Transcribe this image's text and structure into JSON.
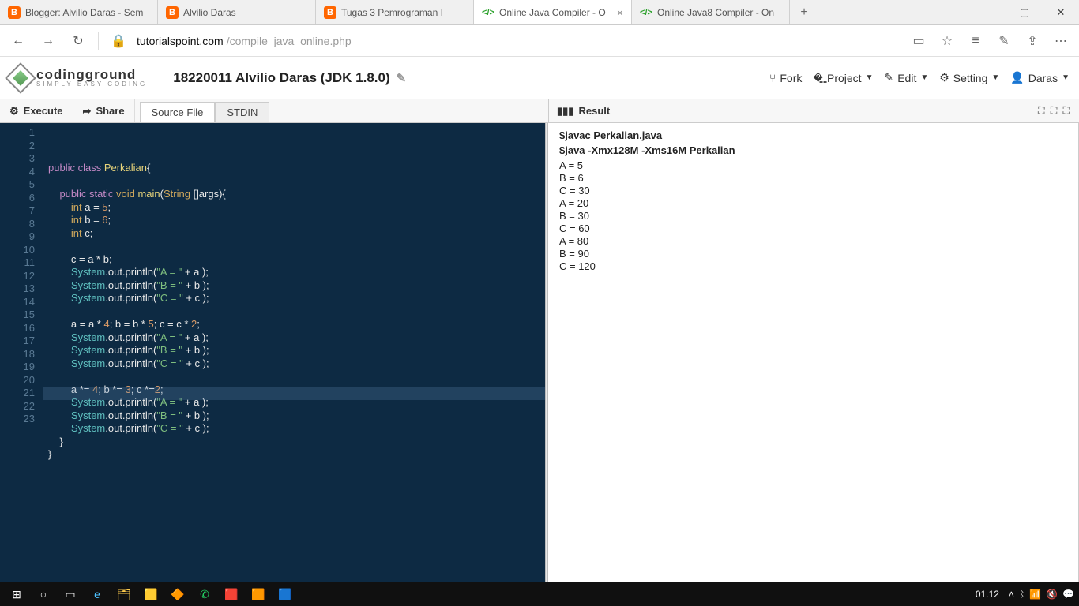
{
  "browserTabs": [
    {
      "icon": "B",
      "iconClass": "blogger-ico",
      "label": "Blogger: Alvilio Daras - Sem"
    },
    {
      "icon": "B",
      "iconClass": "blogger-ico",
      "label": "Alvilio Daras"
    },
    {
      "icon": "B",
      "iconClass": "blogger-ico",
      "label": "Tugas 3 Pemrograman I"
    },
    {
      "icon": "</>",
      "iconClass": "tp-ico",
      "label": "Online Java Compiler - O",
      "active": true
    },
    {
      "icon": "</>",
      "iconClass": "tp-ico",
      "label": "Online Java8 Compiler - On"
    }
  ],
  "url": {
    "host": "tutorialspoint.com",
    "path": "/compile_java_online.php"
  },
  "logo": {
    "main": "codingground",
    "sub": "SIMPLY EASY CODING"
  },
  "pageTitle": "18220011 Alvilio Daras (JDK 1.8.0)",
  "headerActions": {
    "fork": "Fork",
    "project": "Project",
    "edit": "Edit",
    "setting": "Setting",
    "user": "Daras"
  },
  "toolbar": {
    "execute": "Execute",
    "share": "Share"
  },
  "editorTabs": {
    "source": "Source File",
    "stdin": "STDIN"
  },
  "resultLabel": "Result",
  "lineCount": 23,
  "highlightLine": 21,
  "resultCmds": [
    "$javac Perkalian.java",
    "$java -Xmx128M -Xms16M Perkalian"
  ],
  "resultOutput": [
    "A = 5",
    "B = 6",
    "C = 30",
    "A = 20",
    "B = 30",
    "C = 60",
    "A = 80",
    "B = 90",
    "C = 120"
  ],
  "taskbarClock": "01.12",
  "code": {
    "l1": {
      "a": "public class ",
      "b": "Perkalian",
      "c": "{"
    },
    "l3": {
      "a": "    public static ",
      "b": "void ",
      "c": "main",
      "d": "(",
      "e": "String ",
      "f": "[]args){"
    },
    "l4": {
      "a": "        int ",
      "b": "a ",
      "c": "= ",
      "d": "5",
      "e": ";"
    },
    "l5": {
      "a": "        int ",
      "b": "b ",
      "c": "= ",
      "d": "6",
      "e": ";"
    },
    "l6": {
      "a": "        int ",
      "b": "c;"
    },
    "l8": {
      "a": "        c ",
      "b": "= a * b;"
    },
    "p": {
      "sys": "System",
      "rest": ".out.println(",
      "q": "\"A = \" ",
      "plus": "+ a );"
    },
    "pB": {
      "q": "\"B = \" ",
      "plus": "+ b );"
    },
    "pC": {
      "q": "\"C = \" ",
      "plus": "+ c );"
    },
    "l13": "        a = a * 4; b = b * 5; c = c * 2;",
    "l18": "        a *= 4; b *= 3; c *=2;",
    "n4": "4",
    "n5b": "5",
    "n2": "2",
    "n3": "3",
    "close1": "    }",
    "close2": "}"
  }
}
